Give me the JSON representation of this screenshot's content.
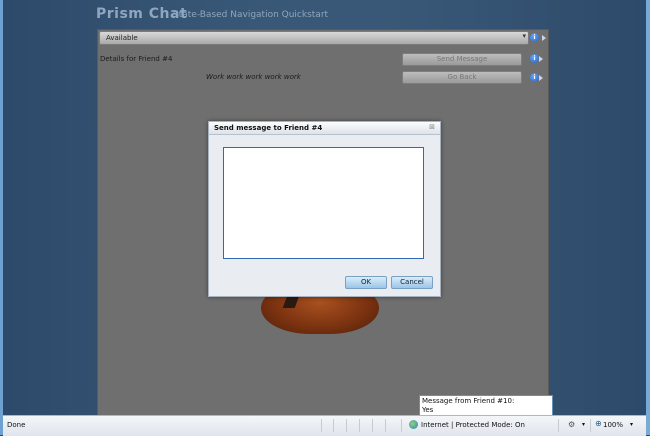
{
  "app": {
    "title": "Prism Chat",
    "subtitle": "State-Based Navigation Quickstart"
  },
  "status_dropdown": {
    "selected": "Available"
  },
  "details": {
    "label": "Details for  Friend #4",
    "message_line": "Work work work work work"
  },
  "buttons": {
    "send_message": "Send Message",
    "go_back": "Go Back"
  },
  "dialog": {
    "title": "Send message to Friend #4",
    "message_value": "",
    "ok_label": "OK",
    "cancel_label": "Cancel"
  },
  "toast": {
    "line1": "Message from Friend #10:",
    "line2": "Yes"
  },
  "browser_status": {
    "left_text": "Done",
    "zone_text": "Internet | Protected Mode: On",
    "zoom_text": "100%"
  },
  "icons": {
    "info": "info-icon",
    "dropdown": "chevron-down-icon",
    "globe": "globe-icon",
    "zoom": "zoom-icon"
  },
  "colors": {
    "background": "#395877",
    "panel": "#6f6f6f",
    "accent_blue": "#2e6ab7"
  }
}
